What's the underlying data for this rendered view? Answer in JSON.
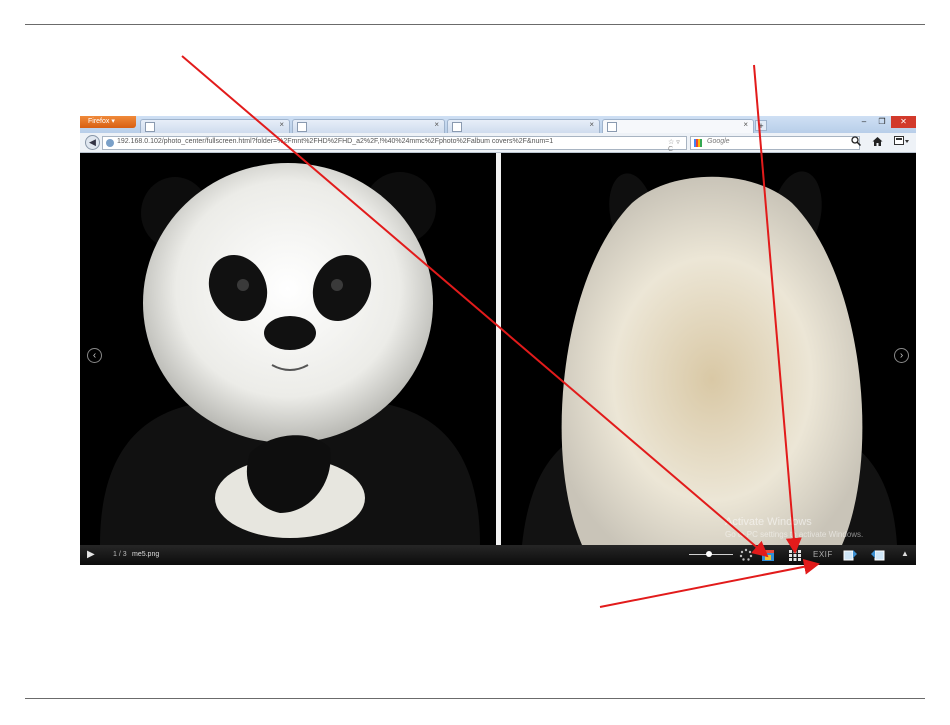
{
  "browser": {
    "menu_button": "Firefox",
    "tab_close": "×",
    "new_tab": "+",
    "win_min": "‒",
    "win_max": "❐",
    "win_close": "✕",
    "url": "192.168.0.102/photo_center/fullscreen.html?folder=%2Fmnt%2FHD%2FHD_a2%2F,!%40%24mmc%2Fphoto%2Falbum covers%2F&num=1",
    "url_icons": "☆ ▿ C",
    "search_placeholder": "Google",
    "icons": {
      "back": "back-arrow-icon",
      "site": "globe-icon",
      "search_engine": "google-icon",
      "search": "magnifier-icon",
      "home": "home-icon",
      "menu": "menu-icon"
    }
  },
  "viewer": {
    "prev": "‹",
    "next": "›",
    "watermark_title": "Activate Windows",
    "watermark_sub": "Go to PC settings to activate Windows."
  },
  "toolbar": {
    "play": "▶",
    "counter": "1 / 3",
    "filename": "me5.png",
    "exif": "EXIF",
    "up": "▲",
    "icons": [
      "zoom-slider-icon",
      "loading-spinner-icon",
      "calendar-icon",
      "grid-view-icon",
      "exif-icon",
      "rotate-left-icon",
      "rotate-right-icon",
      "toggle-up-icon"
    ]
  },
  "colors": {
    "annotation_arrow": "#e21b1b",
    "firefox_button": "#e8711f",
    "close_button": "#d23a2b",
    "viewer_bg": "#000000"
  }
}
